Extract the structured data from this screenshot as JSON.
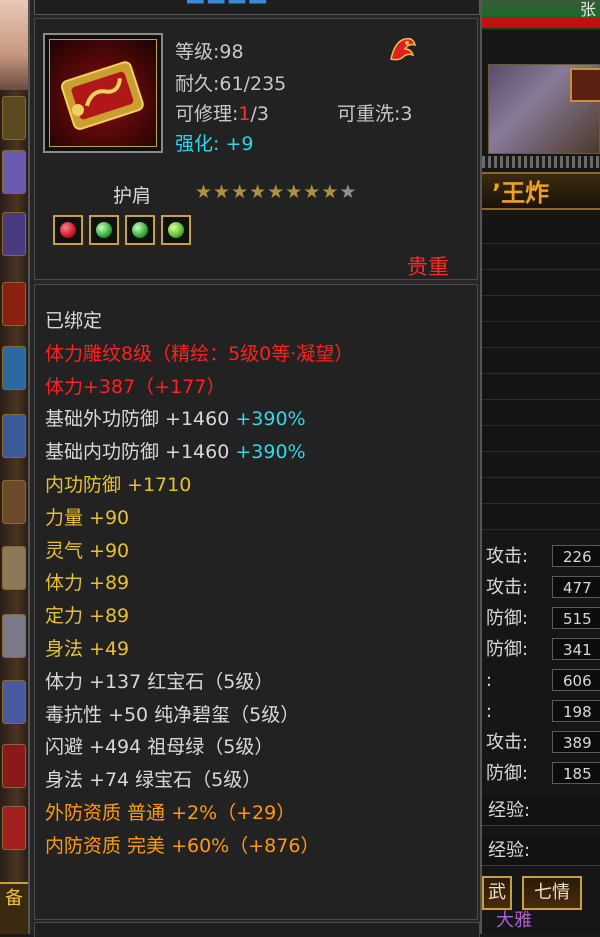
{
  "item": {
    "level_label": "等级:98",
    "durability_label": "耐久:61/235",
    "repairable_prefix": "可修理:",
    "repairable_current": "1",
    "repairable_suffix": "/3",
    "rewash_label": "可重洗:3",
    "enhance_label": "强化: +9",
    "name": "护肩",
    "stars_filled": 8,
    "stars_total": 9,
    "rarity": "贵重"
  },
  "gems": [
    {
      "name": "red-gem",
      "color": "#d02030"
    },
    {
      "name": "green-gem",
      "color": "#40b040"
    },
    {
      "name": "green-gem",
      "color": "#40b040"
    },
    {
      "name": "emerald-gem",
      "color": "#60c030"
    }
  ],
  "stats": [
    {
      "segments": [
        {
          "text": "已绑定",
          "color": "white"
        }
      ]
    },
    {
      "segments": [
        {
          "text": "体力雕纹8级（精绘：5级0等·凝望）",
          "color": "red"
        }
      ]
    },
    {
      "segments": [
        {
          "text": "体力+387（+177）",
          "color": "red"
        }
      ]
    },
    {
      "segments": [
        {
          "text": "基础外功防御 +1460 ",
          "color": "white"
        },
        {
          "text": "+390%",
          "color": "cyan"
        }
      ]
    },
    {
      "segments": [
        {
          "text": "基础内功防御 +1460 ",
          "color": "white"
        },
        {
          "text": "+390%",
          "color": "cyan"
        }
      ]
    },
    {
      "segments": [
        {
          "text": "内功防御 +1710",
          "color": "yellow"
        }
      ]
    },
    {
      "segments": [
        {
          "text": "力量 +90",
          "color": "yellow"
        }
      ]
    },
    {
      "segments": [
        {
          "text": "灵气 +90",
          "color": "yellow"
        }
      ]
    },
    {
      "segments": [
        {
          "text": "体力 +89",
          "color": "yellow"
        }
      ]
    },
    {
      "segments": [
        {
          "text": "定力 +89",
          "color": "yellow"
        }
      ]
    },
    {
      "segments": [
        {
          "text": "身法 +49",
          "color": "yellow"
        }
      ]
    },
    {
      "segments": [
        {
          "text": "体力 +137 红宝石（5级）",
          "color": "white"
        }
      ]
    },
    {
      "segments": [
        {
          "text": "毒抗性 +50 纯净碧玺（5级）",
          "color": "white"
        }
      ]
    },
    {
      "segments": [
        {
          "text": "闪避 +494 祖母绿（5级）",
          "color": "white"
        }
      ]
    },
    {
      "segments": [
        {
          "text": "身法 +74 绿宝石（5级）",
          "color": "white"
        }
      ]
    },
    {
      "segments": [
        {
          "text": "外防资质  普通 +2%（+29）",
          "color": "orange"
        }
      ]
    },
    {
      "segments": [
        {
          "text": "内防资质  完美 +60%（+876）",
          "color": "orange"
        }
      ]
    }
  ],
  "right_panel": {
    "top_name": "张",
    "title_text": "’王炸",
    "stat_rows": [
      {
        "label": "攻击:",
        "value": "226"
      },
      {
        "label": "攻击:",
        "value": "477"
      },
      {
        "label": "防御:",
        "value": "515"
      },
      {
        "label": "防御:",
        "value": "341"
      },
      {
        "label": ":",
        "value": "606"
      },
      {
        "label": ":",
        "value": "198"
      },
      {
        "label": "攻击:",
        "value": "389"
      },
      {
        "label": "防御:",
        "value": "185"
      }
    ],
    "exp_rows": [
      "经验:",
      "经验:"
    ],
    "tab_left": "武",
    "tab_right": "七情",
    "bottom_text": "大雅"
  },
  "left_strip": {
    "bottom_label": "备"
  },
  "colors": {
    "white": "#d8d8d8",
    "red": "#ff2020",
    "yellow": "#e8c030",
    "orange": "#ff9a10",
    "cyan": "#30d8e8",
    "gold_border": "#c9a040"
  }
}
